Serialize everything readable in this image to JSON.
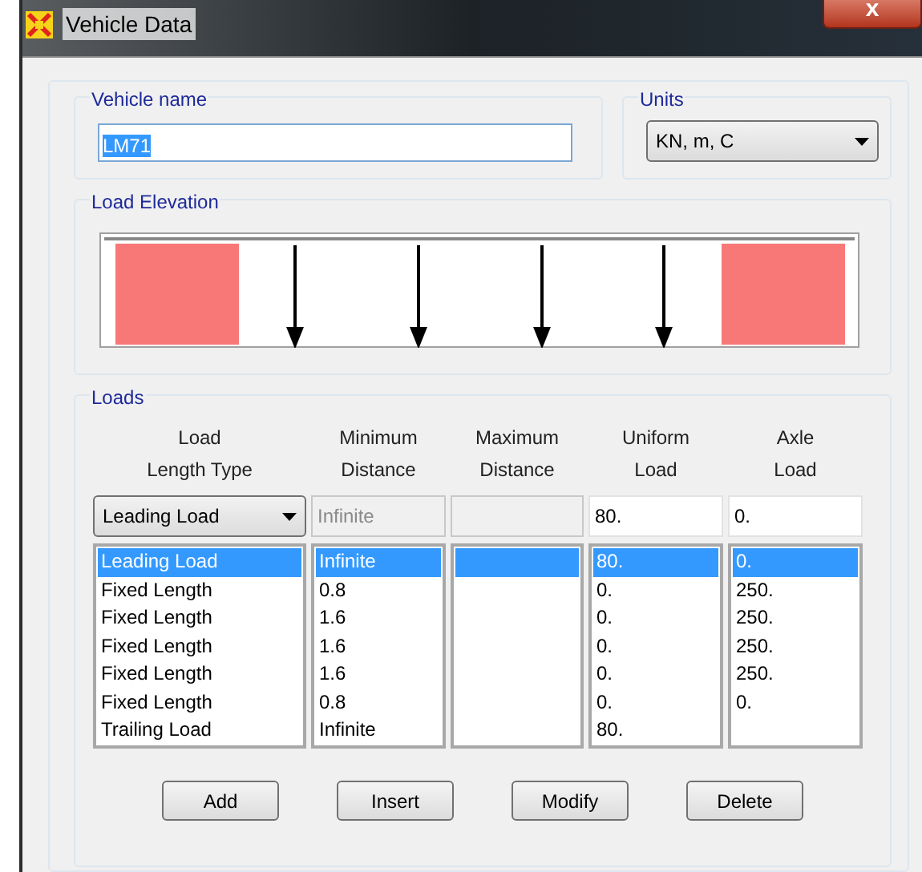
{
  "window": {
    "title": "Vehicle Data",
    "close": "x"
  },
  "vehicle_name": {
    "label": "Vehicle name",
    "value": "LM71"
  },
  "units": {
    "label": "Units",
    "value": "KN, m, C"
  },
  "load_elevation": {
    "label": "Load Elevation"
  },
  "loads": {
    "label": "Loads",
    "columns": [
      [
        "Load",
        "Length Type"
      ],
      [
        "Minimum",
        "Distance"
      ],
      [
        "Maximum",
        "Distance"
      ],
      [
        "Uniform",
        "Load"
      ],
      [
        "Axle",
        "Load"
      ]
    ],
    "editor": {
      "length_type": "Leading Load",
      "minimum_distance": {
        "value": "Infinite",
        "disabled": true
      },
      "maximum_distance": {
        "disabled": true
      },
      "uniform_load": {
        "value": "80.",
        "disabled": false
      },
      "axle_load": {
        "value": "0.",
        "disabled": false
      }
    },
    "rows": [
      {
        "length_type": "Leading Load",
        "minimum_distance": "Infinite",
        "uniform_load": "80.",
        "axle_load": "0.",
        "selected": true
      },
      {
        "length_type": "Fixed Length",
        "minimum_distance": "0.8",
        "uniform_load": "0.",
        "axle_load": "250.",
        "selected": false
      },
      {
        "length_type": "Fixed Length",
        "minimum_distance": "1.6",
        "uniform_load": "0.",
        "axle_load": "250.",
        "selected": false
      },
      {
        "length_type": "Fixed Length",
        "minimum_distance": "1.6",
        "uniform_load": "0.",
        "axle_load": "250.",
        "selected": false
      },
      {
        "length_type": "Fixed Length",
        "minimum_distance": "1.6",
        "uniform_load": "0.",
        "axle_load": "250.",
        "selected": false
      },
      {
        "length_type": "Fixed Length",
        "minimum_distance": "0.8",
        "uniform_load": "0.",
        "axle_load": "0.",
        "selected": false
      },
      {
        "length_type": "Trailing Load",
        "minimum_distance": "Infinite",
        "uniform_load": "80.",
        "selected": false
      }
    ],
    "buttons": [
      "Add",
      "Insert",
      "Modify",
      "Delete"
    ]
  }
}
